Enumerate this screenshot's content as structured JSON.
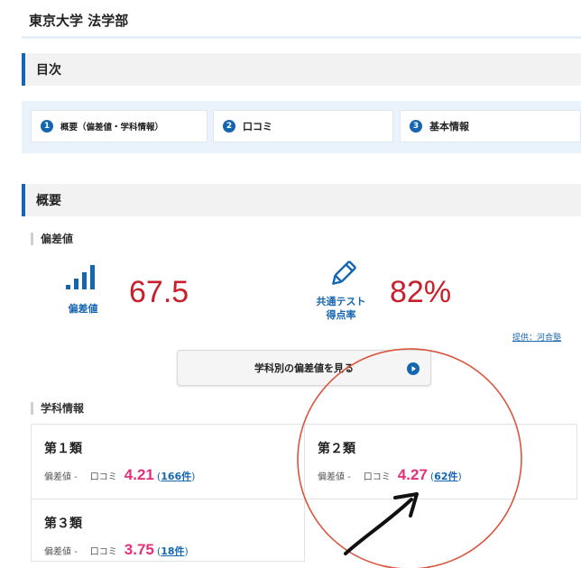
{
  "page": {
    "title": "東京大学 法学部"
  },
  "toc": {
    "heading": "目次",
    "items": [
      {
        "num": "1",
        "label": "概要（偏差値・学科情報）"
      },
      {
        "num": "2",
        "label": "口コミ"
      },
      {
        "num": "3",
        "label": "基本情報"
      }
    ]
  },
  "summary": {
    "heading": "概要",
    "hensachi_subheading": "偏差値",
    "hensachi": {
      "caption": "偏差値",
      "value": "67.5"
    },
    "test": {
      "caption_line1": "共通テスト",
      "caption_line2": "得点率",
      "value": "82%"
    },
    "provider": "提供：河合塾",
    "button_label": "学科別の偏差値を見る",
    "dept_subheading": "学科情報"
  },
  "departments": [
    {
      "name": "第１類",
      "hensachi": "偏差値 -",
      "review_label": "口コミ",
      "rating": "4.21",
      "open": "(",
      "count": "166件",
      "close": ")"
    },
    {
      "name": "第２類",
      "hensachi": "偏差値 -",
      "review_label": "口コミ",
      "rating": "4.27",
      "open": "(",
      "count": "62件",
      "close": ")"
    },
    {
      "name": "第３類",
      "hensachi": "偏差値 -",
      "review_label": "口コミ",
      "rating": "3.75",
      "open": "(",
      "count": "18件",
      "close": ")"
    }
  ],
  "colors": {
    "accent_blue": "#1566b0",
    "value_red": "#c8202a",
    "rating_pink": "#e4307a",
    "annotation_red": "#d9553f"
  },
  "icons": {
    "hensachi": "bar-chart-icon",
    "test": "pencil-icon",
    "button": "play-circle-icon"
  }
}
